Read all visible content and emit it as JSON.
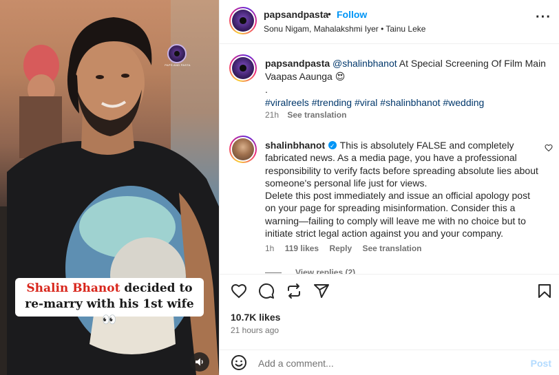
{
  "media": {
    "watermark_text": "PAPS AND PASTA",
    "caption_highlight": "Shalin Bhanot",
    "caption_line1_rest": " decided to",
    "caption_line2": "re-marry with his 1st wife",
    "caption_emoji": "👀",
    "audio_icon": "speaker-icon"
  },
  "header": {
    "username": "papsandpasta",
    "separator": "•",
    "follow_label": "Follow",
    "audio_info": "Sonu Nigam, Mahalakshmi Iyer • Tainu Leke",
    "more_label": "···"
  },
  "caption": {
    "username": "papsandpasta",
    "mention": "@shalinbhanot",
    "text": " At Special Screening Of Film Main Vaapas Aaunga ",
    "emoji": "😍",
    "dot_line": ".",
    "hashtags": "#viralreels #trending #viral #shalinbhanot #wedding",
    "time": "21h",
    "see_translation": "See translation"
  },
  "comment": {
    "username": "shalinbhanot",
    "text1": " This is absolutely FALSE and completely fabricated news. As a media page, you have a professional responsibility to verify facts before spreading absolute lies about someone's personal life just for views.",
    "text2": "Delete this post immediately and issue an official apology post on your page for spreading misinformation. Consider this a warning—failing to comply will leave me with no choice but to initiate strict legal action against you and your company.",
    "time": "1h",
    "likes": "119 likes",
    "reply": "Reply",
    "see_translation": "See translation",
    "view_replies": "View replies (2)"
  },
  "stats": {
    "likes": "10.7K likes",
    "posted": "21 hours ago"
  },
  "add_comment": {
    "placeholder": "Add a comment...",
    "post_label": "Post"
  },
  "colors": {
    "link_blue": "#0095f6",
    "hashtag": "#00376b",
    "caption_red": "#d8261c",
    "muted": "#737373"
  }
}
